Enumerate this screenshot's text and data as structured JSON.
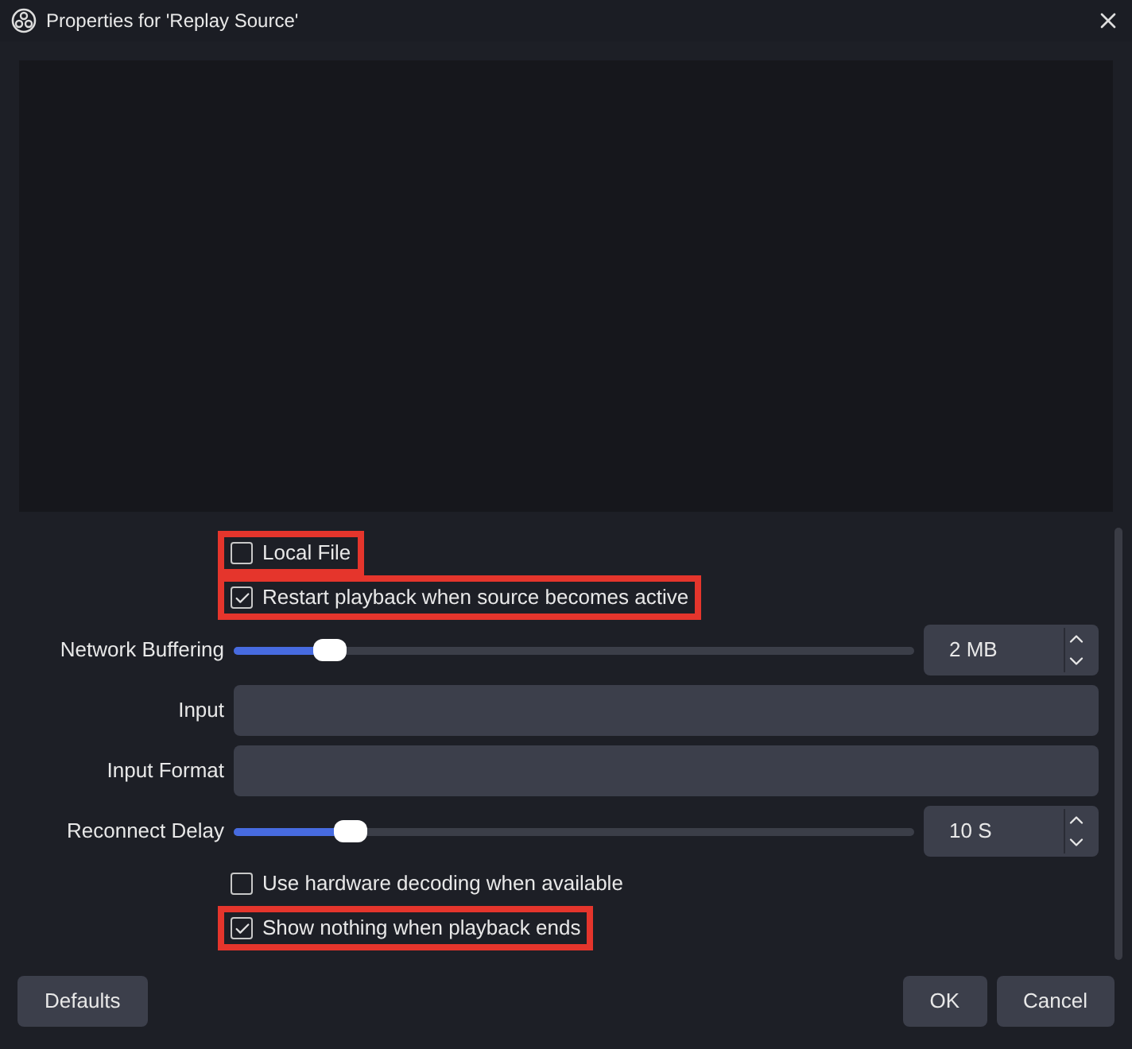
{
  "window": {
    "title": "Properties for 'Replay Source'"
  },
  "settings": [
    {
      "kind": "checkbox",
      "label": "Local File",
      "checked": false,
      "highlighted": true
    },
    {
      "kind": "checkbox",
      "label": "Restart playback when source becomes active",
      "checked": true,
      "highlighted": true
    },
    {
      "kind": "slider",
      "label": "Network Buffering",
      "level": 0.14,
      "value": "2 MB"
    },
    {
      "kind": "text",
      "label": "Input"
    },
    {
      "kind": "text",
      "label": "Input Format"
    },
    {
      "kind": "slider",
      "label": "Reconnect Delay",
      "level": 0.17,
      "value": "10 S"
    },
    {
      "kind": "checkbox",
      "label": "Use hardware decoding when available",
      "checked": false,
      "highlighted": false
    },
    {
      "kind": "checkbox",
      "label": "Show nothing when playback ends",
      "checked": true,
      "highlighted": true
    }
  ],
  "buttons": {
    "left": [
      "Defaults"
    ],
    "right": [
      "OK",
      "Cancel"
    ]
  }
}
